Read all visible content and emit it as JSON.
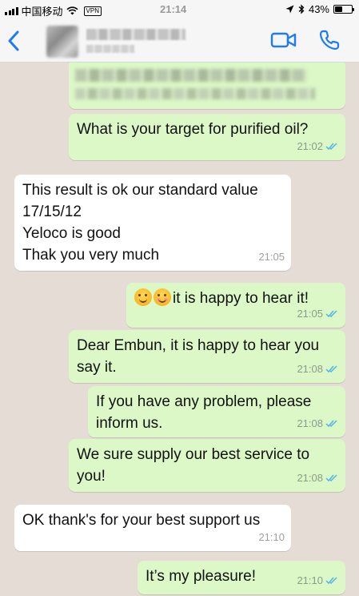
{
  "status_bar": {
    "carrier": "中国移动",
    "vpn": "VPN",
    "time": "21:14",
    "battery": "43%",
    "battery_level": 0.43
  },
  "header": {
    "back_icon": "chevron-left-icon",
    "video_icon": "video-call-icon",
    "call_icon": "phone-icon"
  },
  "colors": {
    "accent": "#1f7af5",
    "outgoing_bubble": "#dcf8c6",
    "incoming_bubble": "#ffffff",
    "read_ticks": "#4fb6ec",
    "chat_background": "#e5ddd5"
  },
  "messages": [
    {
      "direction": "out",
      "text": "What is your target for purified oil?",
      "time": "21:02",
      "status": "read"
    },
    {
      "direction": "in",
      "lines": [
        "This result is ok our standard value",
        "17/15/12",
        "Yeloco is good",
        "Thak you very much"
      ],
      "time": "21:05"
    },
    {
      "direction": "out",
      "text": "it is happy to hear it!",
      "time": "21:05",
      "status": "read"
    },
    {
      "direction": "out",
      "lines": [
        "Dear Embun, it is happy to hear you",
        "say it."
      ],
      "time": "21:08",
      "status": "read"
    },
    {
      "direction": "out",
      "lines": [
        "If you have any problem, please",
        "inform us."
      ],
      "time": "21:08",
      "status": "read"
    },
    {
      "direction": "out",
      "lines": [
        "We sure supply our best service to",
        "you!"
      ],
      "time": "21:08",
      "status": "read"
    },
    {
      "direction": "in",
      "text": "OK thank's for your best support us",
      "time": "21:10"
    },
    {
      "direction": "out",
      "text": "It’s my pleasure!",
      "time": "21:10",
      "status": "read"
    }
  ]
}
